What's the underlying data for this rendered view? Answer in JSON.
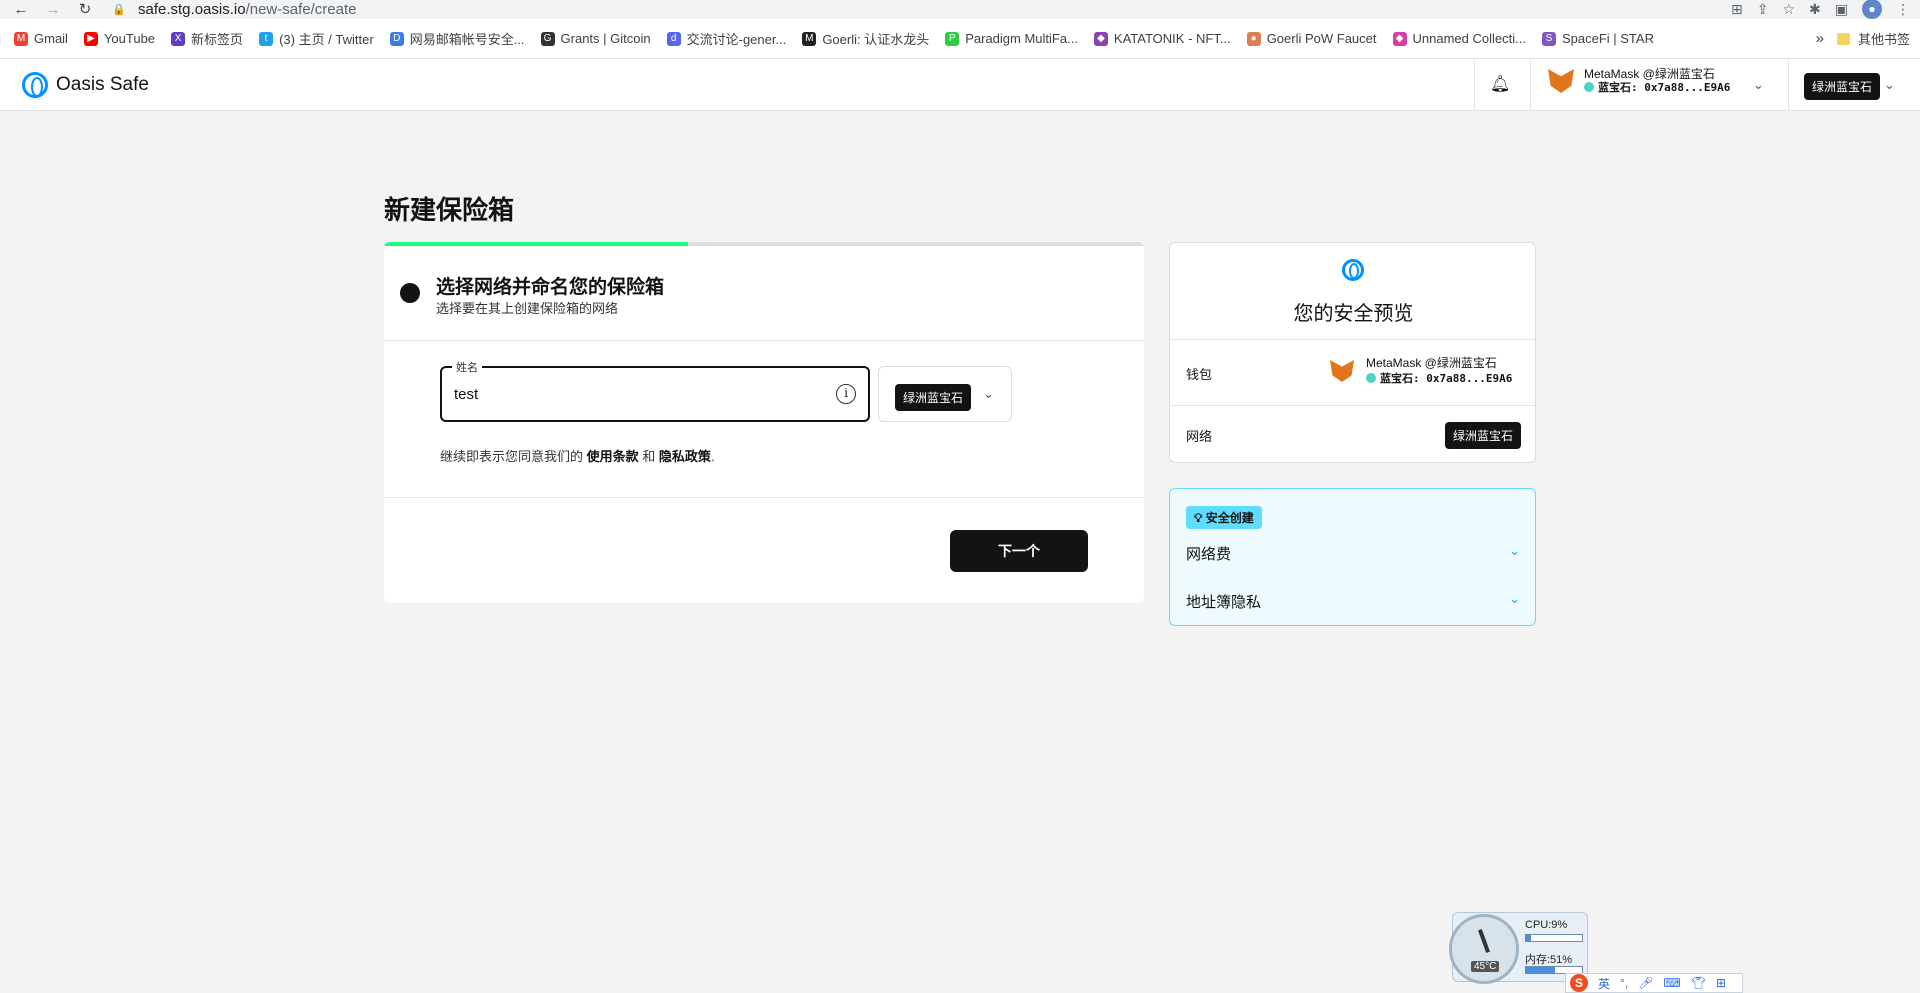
{
  "browser": {
    "url_host": "safe.stg.oasis.io",
    "url_path": "/new-safe/create",
    "bookmarks": [
      {
        "label": "Gmail",
        "color": "#ea4335",
        "icon": "M"
      },
      {
        "label": "YouTube",
        "color": "#ff0000",
        "icon": "▶"
      },
      {
        "label": "新标签页",
        "color": "#5f3dc4",
        "icon": "X"
      },
      {
        "label": "(3) 主页 / Twitter",
        "color": "#1da1f2",
        "icon": "t"
      },
      {
        "label": "网易邮箱帐号安全...",
        "color": "#3b7de0",
        "icon": "D"
      },
      {
        "label": "Grants | Gitcoin",
        "color": "#333333",
        "icon": "G"
      },
      {
        "label": "交流讨论-gener...",
        "color": "#5865f2",
        "icon": "d"
      },
      {
        "label": "Goerli: 认证水龙头",
        "color": "#222222",
        "icon": "M"
      },
      {
        "label": "Paradigm MultiFa...",
        "color": "#2ecc40",
        "icon": "P"
      },
      {
        "label": "KATATONIK - NFT...",
        "color": "#8e44ad",
        "icon": "◆"
      },
      {
        "label": "Goerli PoW Faucet",
        "color": "#e07b53",
        "icon": "●"
      },
      {
        "label": "Unnamed Collecti...",
        "color": "#d63fa7",
        "icon": "◆"
      },
      {
        "label": "SpaceFi | STAR",
        "color": "#7e57c2",
        "icon": "S"
      }
    ],
    "more": "»",
    "other_bookmarks": "其他书签"
  },
  "header": {
    "logo_text": "Oasis Safe",
    "wallet_name": "MetaMask @绿洲蓝宝石",
    "wallet_address": "蓝宝石: 0x7a88...E9A6",
    "network": "绿洲蓝宝石"
  },
  "page": {
    "title": "新建保险箱",
    "progress": 0.4
  },
  "step": {
    "title": "选择网络并命名您的保险箱",
    "subtitle": "选择要在其上创建保险箱的网络"
  },
  "form": {
    "name_label": "姓名",
    "name_value": "test",
    "network_chip": "绿洲蓝宝石",
    "terms_prefix": "继续即表示您同意我们的",
    "terms_link": "使用条款",
    "terms_and": "和",
    "privacy_link": "隐私政策",
    "terms_suffix": ".",
    "next_label": "下一个"
  },
  "preview": {
    "title": "您的安全预览",
    "wallet_key": "钱包",
    "wallet_name": "MetaMask @绿洲蓝宝石",
    "wallet_address": "蓝宝石: 0x7a88...E9A6",
    "network_key": "网络",
    "network_value": "绿洲蓝宝石"
  },
  "tips": {
    "badge": "安全创建",
    "items": [
      "网络费",
      "地址簿隐私"
    ]
  },
  "system": {
    "cpu_label": "CPU:9%",
    "cpu": 0.09,
    "mem_label": "内存:51%",
    "mem": 0.51,
    "temp": "45°C",
    "ime_lang": "英"
  }
}
